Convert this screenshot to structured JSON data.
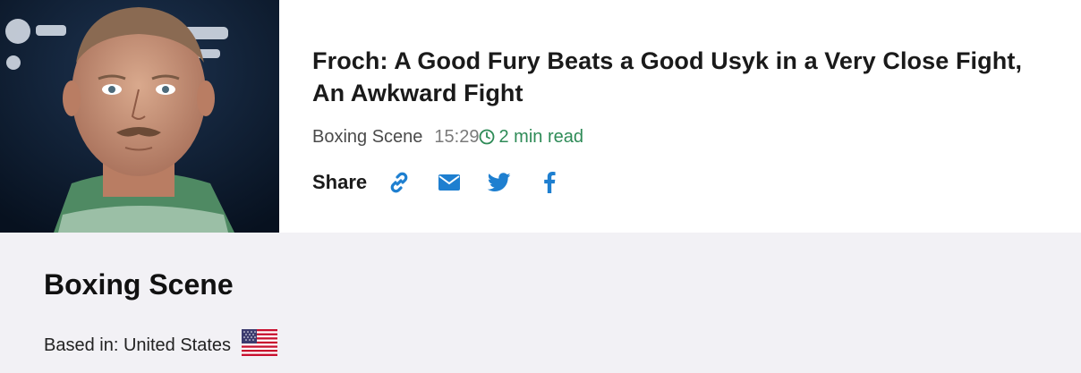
{
  "article": {
    "headline": "Froch: A Good Fury Beats a Good Usyk in a Very Close Fight, An Awkward Fight",
    "source": "Boxing Scene",
    "time": "15:29",
    "read_time": "2 min read",
    "share_label": "Share",
    "share_icons": [
      "link-icon",
      "envelope-icon",
      "twitter-icon",
      "facebook-icon"
    ],
    "thumbnail_icon": "boxer-portrait"
  },
  "source_panel": {
    "name": "Boxing Scene",
    "based_in": "Based in: United States",
    "flag_icon": "us-flag-icon"
  },
  "colors": {
    "share_blue": "#1e7fd0",
    "read_green": "#2e8b57",
    "panel_bg": "#f2f1f5"
  }
}
